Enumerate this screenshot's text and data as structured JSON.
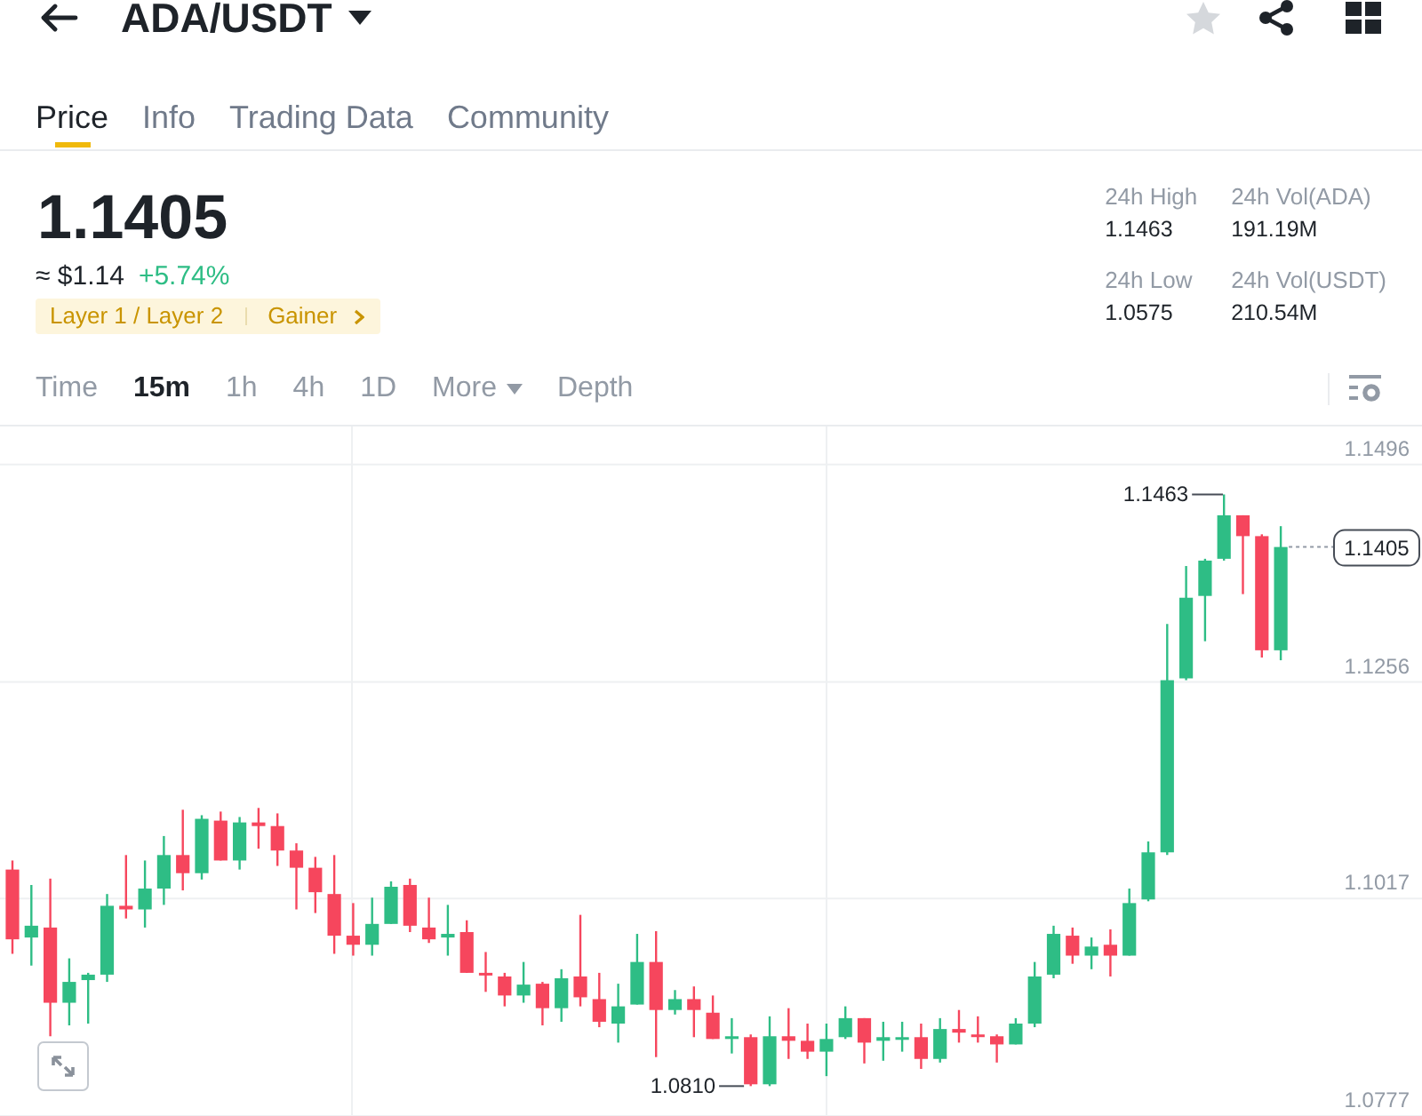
{
  "header": {
    "title": "ADA/USDT",
    "favorited": false
  },
  "tabs": [
    {
      "label": "Price",
      "selected": true
    },
    {
      "label": "Info",
      "selected": false
    },
    {
      "label": "Trading Data",
      "selected": false
    },
    {
      "label": "Community",
      "selected": false
    }
  ],
  "ticker": {
    "price": "1.1405",
    "fiat_value": "≈ $1.14",
    "change": "+5.74%",
    "positive": true,
    "tags": [
      "Layer 1 / Layer 2",
      "Gainer"
    ]
  },
  "stats": [
    {
      "label": "24h High",
      "value": "1.1463"
    },
    {
      "label": "24h Vol(ADA)",
      "value": "191.19M"
    },
    {
      "label": "24h Low",
      "value": "1.0575"
    },
    {
      "label": "24h Vol(USDT)",
      "value": "210.54M"
    }
  ],
  "intervals": [
    {
      "label": "Time",
      "kind": "option",
      "selected": false
    },
    {
      "label": "15m",
      "kind": "option",
      "selected": true
    },
    {
      "label": "1h",
      "kind": "option",
      "selected": false
    },
    {
      "label": "4h",
      "kind": "option",
      "selected": false
    },
    {
      "label": "1D",
      "kind": "option",
      "selected": false
    },
    {
      "label": "More",
      "kind": "dropdown",
      "selected": false
    },
    {
      "label": "Depth",
      "kind": "option",
      "selected": false
    }
  ],
  "chart": {
    "chart_data": {
      "type": "candlestick",
      "ylim": [
        1.0777,
        1.1538
      ],
      "yticks": [
        1.1496,
        1.1256,
        1.1017,
        1.0777
      ],
      "grid": true,
      "ohlc": [
        [
          1.1049,
          1.1059,
          1.0956,
          1.0972
        ],
        [
          1.0974,
          1.1032,
          1.0943,
          1.0987
        ],
        [
          1.0985,
          1.1039,
          1.0865,
          1.0902
        ],
        [
          1.0902,
          1.0951,
          1.0877,
          1.0925
        ],
        [
          1.0927,
          1.0935,
          1.0879,
          1.0933
        ],
        [
          1.0933,
          1.1022,
          1.0925,
          1.1009
        ],
        [
          1.1009,
          1.1065,
          1.0995,
          1.1005
        ],
        [
          1.1005,
          1.1059,
          1.0985,
          1.1028
        ],
        [
          1.1028,
          1.1086,
          1.101,
          1.1065
        ],
        [
          1.1065,
          1.1115,
          1.1026,
          1.1045
        ],
        [
          1.1045,
          1.1109,
          1.1038,
          1.1105
        ],
        [
          1.1103,
          1.1113,
          1.1059,
          1.1059
        ],
        [
          1.1059,
          1.1107,
          1.1049,
          1.1101
        ],
        [
          1.1101,
          1.1117,
          1.1072,
          1.1097
        ],
        [
          1.1097,
          1.1111,
          1.1053,
          1.107
        ],
        [
          1.107,
          1.1078,
          1.1005,
          1.1051
        ],
        [
          1.1051,
          1.1063,
          1.1001,
          1.1024
        ],
        [
          1.1022,
          1.1065,
          1.0956,
          1.0976
        ],
        [
          1.0976,
          1.1012,
          1.0954,
          1.0966
        ],
        [
          1.0966,
          1.1018,
          1.0954,
          1.0989
        ],
        [
          1.0989,
          1.1036,
          1.0989,
          1.103
        ],
        [
          1.1032,
          1.1039,
          1.098,
          1.0987
        ],
        [
          1.0985,
          1.1018,
          1.0968,
          1.0972
        ],
        [
          1.0974,
          1.101,
          1.0954,
          1.0978
        ],
        [
          1.098,
          1.0993,
          1.0935,
          1.0935
        ],
        [
          1.0935,
          1.0958,
          1.0914,
          1.0933
        ],
        [
          1.0931,
          1.0935,
          1.0898,
          1.091
        ],
        [
          1.091,
          1.0947,
          1.0902,
          1.0922
        ],
        [
          1.0923,
          1.0925,
          1.0877,
          1.0896
        ],
        [
          1.0896,
          1.0939,
          1.0881,
          1.0929
        ],
        [
          1.0931,
          1.0999,
          1.0898,
          1.0908
        ],
        [
          1.0906,
          1.0935,
          1.0875,
          1.0881
        ],
        [
          1.0879,
          1.0923,
          1.0858,
          1.0898
        ],
        [
          1.09,
          1.0978,
          1.09,
          1.0947
        ],
        [
          1.0947,
          1.0981,
          1.0842,
          1.0894
        ],
        [
          1.0894,
          1.0916,
          1.0889,
          1.0906
        ],
        [
          1.0906,
          1.092,
          1.0864,
          1.0894
        ],
        [
          1.0891,
          1.091,
          1.0862,
          1.0862
        ],
        [
          1.0862,
          1.0885,
          1.0846,
          1.0865
        ],
        [
          1.0864,
          1.0867,
          1.081,
          1.0812
        ],
        [
          1.0812,
          1.0887,
          1.081,
          1.0865
        ],
        [
          1.0865,
          1.0896,
          1.084,
          1.086
        ],
        [
          1.086,
          1.0879,
          1.084,
          1.0848
        ],
        [
          1.0848,
          1.0879,
          1.0821,
          1.0862
        ],
        [
          1.0864,
          1.0898,
          1.0862,
          1.0885
        ],
        [
          1.0885,
          1.0885,
          1.0835,
          1.0858
        ],
        [
          1.086,
          1.0881,
          1.0838,
          1.0864
        ],
        [
          1.0862,
          1.0881,
          1.0848,
          1.0864
        ],
        [
          1.0864,
          1.0879,
          1.0829,
          1.084
        ],
        [
          1.084,
          1.0885,
          1.0836,
          1.0873
        ],
        [
          1.0873,
          1.0894,
          1.0858,
          1.0869
        ],
        [
          1.0867,
          1.0887,
          1.0858,
          1.0865
        ],
        [
          1.0865,
          1.0867,
          1.0836,
          1.0856
        ],
        [
          1.0856,
          1.0885,
          1.0856,
          1.0879
        ],
        [
          1.0879,
          1.0947,
          1.0875,
          1.0931
        ],
        [
          1.0933,
          1.0987,
          1.0929,
          1.0978
        ],
        [
          1.0976,
          1.0985,
          1.0945,
          1.0954
        ],
        [
          1.0954,
          1.0974,
          1.0939,
          1.0964
        ],
        [
          1.0966,
          1.0983,
          1.0931,
          1.0954
        ],
        [
          1.0954,
          1.1028,
          1.0954,
          1.1012
        ],
        [
          1.1016,
          1.108,
          1.1014,
          1.1068
        ],
        [
          1.1068,
          1.132,
          1.1065,
          1.1258
        ],
        [
          1.126,
          1.1384,
          1.1258,
          1.1349
        ],
        [
          1.1351,
          1.1392,
          1.1301,
          1.139
        ],
        [
          1.1392,
          1.1463,
          1.139,
          1.144
        ],
        [
          1.144,
          1.144,
          1.1353,
          1.1417
        ],
        [
          1.1417,
          1.1419,
          1.1283,
          1.1291
        ],
        [
          1.1291,
          1.1428,
          1.128,
          1.1405
        ]
      ]
    },
    "high_label": "1.1463",
    "low_label": "1.0810",
    "last_price": "1.1405"
  }
}
